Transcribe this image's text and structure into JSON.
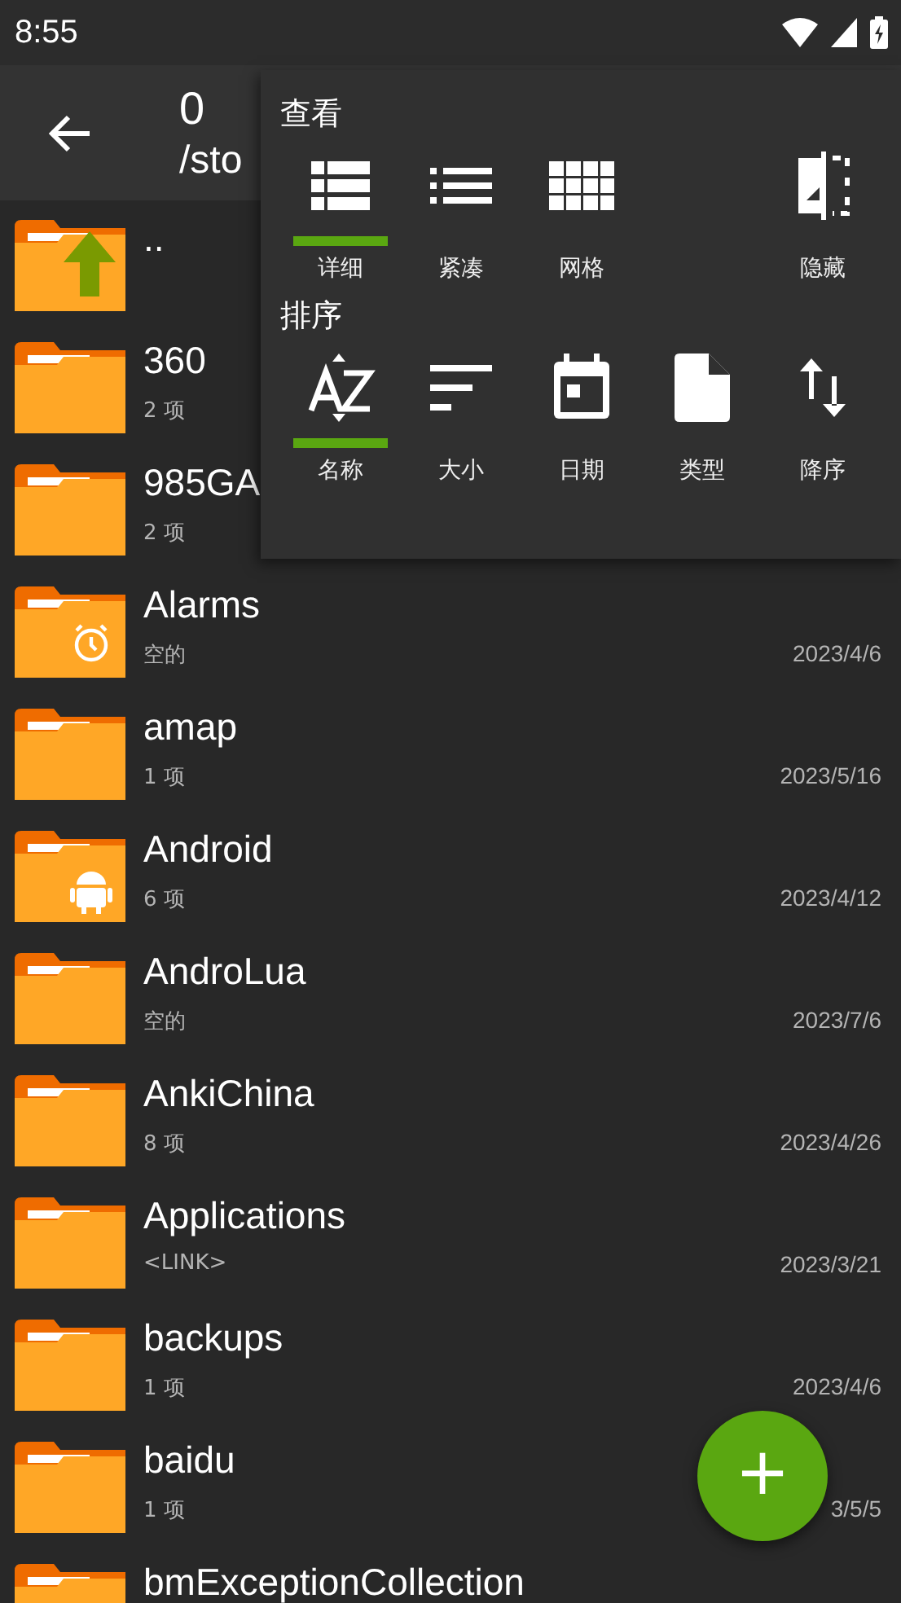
{
  "status_bar": {
    "time": "8:55"
  },
  "toolbar": {
    "title": "0",
    "path": "/sto"
  },
  "files": [
    {
      "kind": "up",
      "name": ".."
    },
    {
      "kind": "folder",
      "name": "360",
      "info": "2 项"
    },
    {
      "kind": "folder",
      "name": "985GA",
      "info": "2 项"
    },
    {
      "kind": "alarm",
      "name": "Alarms",
      "info": "空的",
      "date": "2023/4/6"
    },
    {
      "kind": "folder",
      "name": "amap",
      "info": "1 项",
      "date": "2023/5/16"
    },
    {
      "kind": "android",
      "name": "Android",
      "info": "6 项",
      "date": "2023/4/12"
    },
    {
      "kind": "folder",
      "name": "AndroLua",
      "info": "空的",
      "date": "2023/7/6"
    },
    {
      "kind": "folder",
      "name": "AnkiChina",
      "info": "8 项",
      "date": "2023/4/26"
    },
    {
      "kind": "folder",
      "name": "Applications",
      "info": "<LINK>",
      "date": "2023/3/21"
    },
    {
      "kind": "folder",
      "name": "backups",
      "info": "1 项",
      "date": "2023/4/6"
    },
    {
      "kind": "folder",
      "name": "baidu",
      "info": "1 项",
      "date": "3/5/5"
    },
    {
      "kind": "folder",
      "name": "bmExceptionCollection"
    }
  ],
  "menu": {
    "sections": [
      {
        "title": "查看",
        "items": [
          {
            "label": "详细",
            "kind": "mode",
            "selected": true
          },
          {
            "label": "紧凑",
            "kind": "mode",
            "selected": false
          },
          {
            "label": "网格",
            "kind": "mode",
            "selected": false
          },
          {
            "label": "隐藏",
            "kind": "toggle",
            "selected": false
          }
        ]
      },
      {
        "title": "排序",
        "items": [
          {
            "label": "名称",
            "kind": "sort",
            "selected": true
          },
          {
            "label": "大小",
            "kind": "sort",
            "selected": false
          },
          {
            "label": "日期",
            "kind": "sort",
            "selected": false
          },
          {
            "label": "类型",
            "kind": "sort",
            "selected": false
          },
          {
            "label": "降序",
            "kind": "order",
            "selected": false
          }
        ]
      }
    ]
  },
  "fab": {
    "label": "+"
  }
}
